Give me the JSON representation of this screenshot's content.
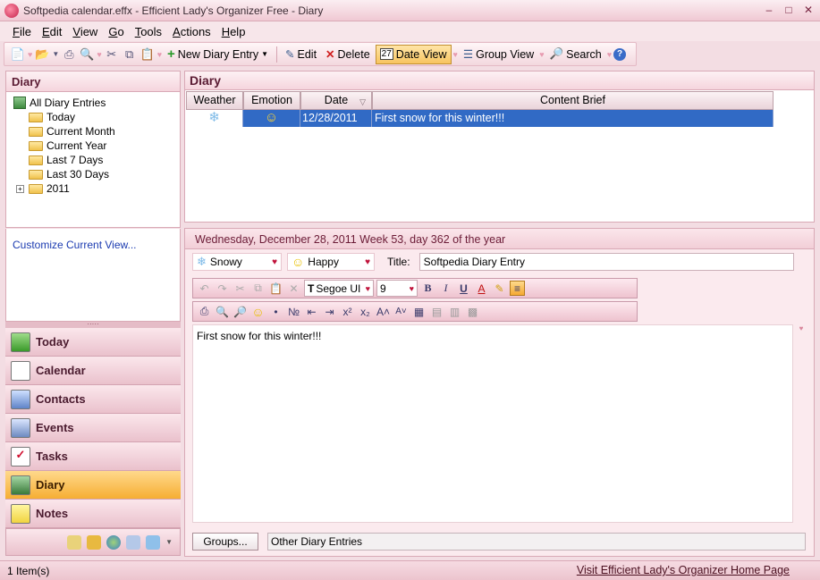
{
  "window": {
    "title": "Softpedia calendar.effx - Efficient Lady's Organizer Free - Diary",
    "minimize": "–",
    "maximize": "□",
    "close": "✕"
  },
  "menu": [
    "File",
    "Edit",
    "View",
    "Go",
    "Tools",
    "Actions",
    "Help"
  ],
  "toolbar": {
    "new_diary_entry": "New Diary Entry",
    "edit": "Edit",
    "delete": "Delete",
    "date_view": "Date View",
    "group_view": "Group View",
    "search": "Search"
  },
  "left": {
    "header": "Diary",
    "tree": {
      "root": "All Diary Entries",
      "items": [
        "Today",
        "Current Month",
        "Current Year",
        "Last 7 Days",
        "Last 30 Days",
        "2011"
      ]
    },
    "customize": "Customize Current View...",
    "nav": [
      "Today",
      "Calendar",
      "Contacts",
      "Events",
      "Tasks",
      "Diary",
      "Notes"
    ],
    "active_nav": "Diary"
  },
  "diary": {
    "header": "Diary",
    "columns": [
      "Weather",
      "Emotion",
      "Date",
      "Content Brief"
    ],
    "rows": [
      {
        "weather": "❄",
        "emotion": "☺",
        "date": "12/28/2011",
        "brief": "First snow for this winter!!!"
      }
    ]
  },
  "entry": {
    "date_line": "Wednesday, December 28, 2011   Week 53, day 362 of the year",
    "weather": "Snowy",
    "emotion": "Happy",
    "title_label": "Title:",
    "title_value": "Softpedia Diary Entry",
    "font_name": "Segoe UI",
    "font_size": "9",
    "body": "First snow for this winter!!!",
    "groups_button": "Groups...",
    "groups_value": "Other Diary Entries"
  },
  "status": {
    "count": "1 Item(s)",
    "link": "Visit Efficient Lady's Organizer Home Page"
  },
  "colors": {
    "accent": "#316ac5",
    "active_nav": "#f6ae33",
    "background": "#f3dde3"
  }
}
